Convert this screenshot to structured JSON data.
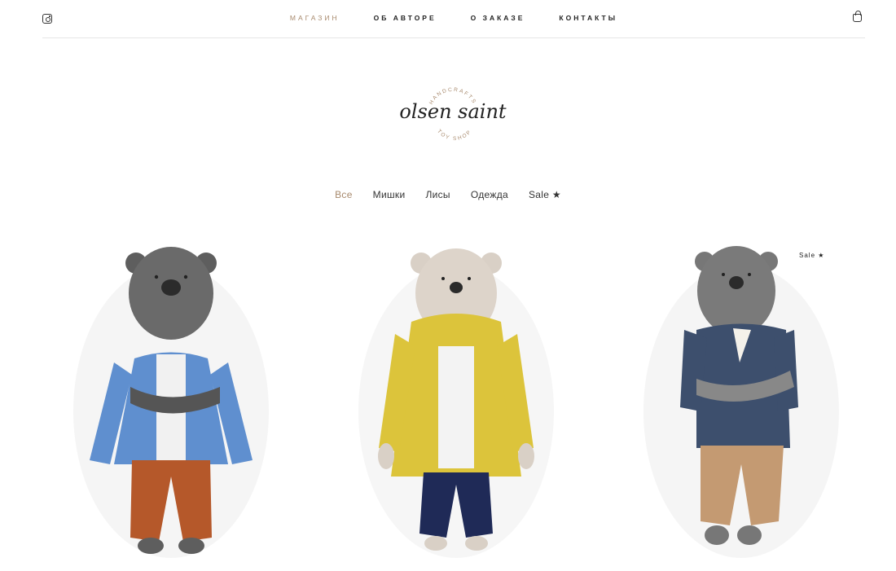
{
  "nav": {
    "items": [
      {
        "label": "МАГАЗИН",
        "active": true
      },
      {
        "label": "ОБ АВТОРЕ",
        "active": false
      },
      {
        "label": "О ЗАКАЗЕ",
        "active": false
      },
      {
        "label": "КОНТАКТЫ",
        "active": false
      }
    ]
  },
  "icons": {
    "instagram": "instagram-icon",
    "cart": "shopping-bag-icon"
  },
  "logo": {
    "script": "olsen saint",
    "arc_top": "HANDCRAFTS",
    "arc_bottom": "TOY SHOP"
  },
  "filters": [
    {
      "label": "Все",
      "active": true
    },
    {
      "label": "Мишки",
      "active": false
    },
    {
      "label": "Лисы",
      "active": false
    },
    {
      "label": "Одежда",
      "active": false
    },
    {
      "label": "Sale ★",
      "active": false
    }
  ],
  "products": {
    "sale_badge": "Sale ★"
  },
  "colors": {
    "accent": "#a88a6d",
    "text": "#222222",
    "divider": "#e6e6e6",
    "bear1_fur": "#5e5e5e",
    "bear1_cardigan": "#5f8fcf",
    "bear1_pants": "#b5582a",
    "bear2_fur": "#d9d0c6",
    "bear2_jacket": "#dcc43b",
    "bear2_pants": "#1f2a57",
    "bear3_fur": "#777777",
    "bear3_sweater": "#3d4f6d",
    "bear3_pants": "#c49a72"
  }
}
